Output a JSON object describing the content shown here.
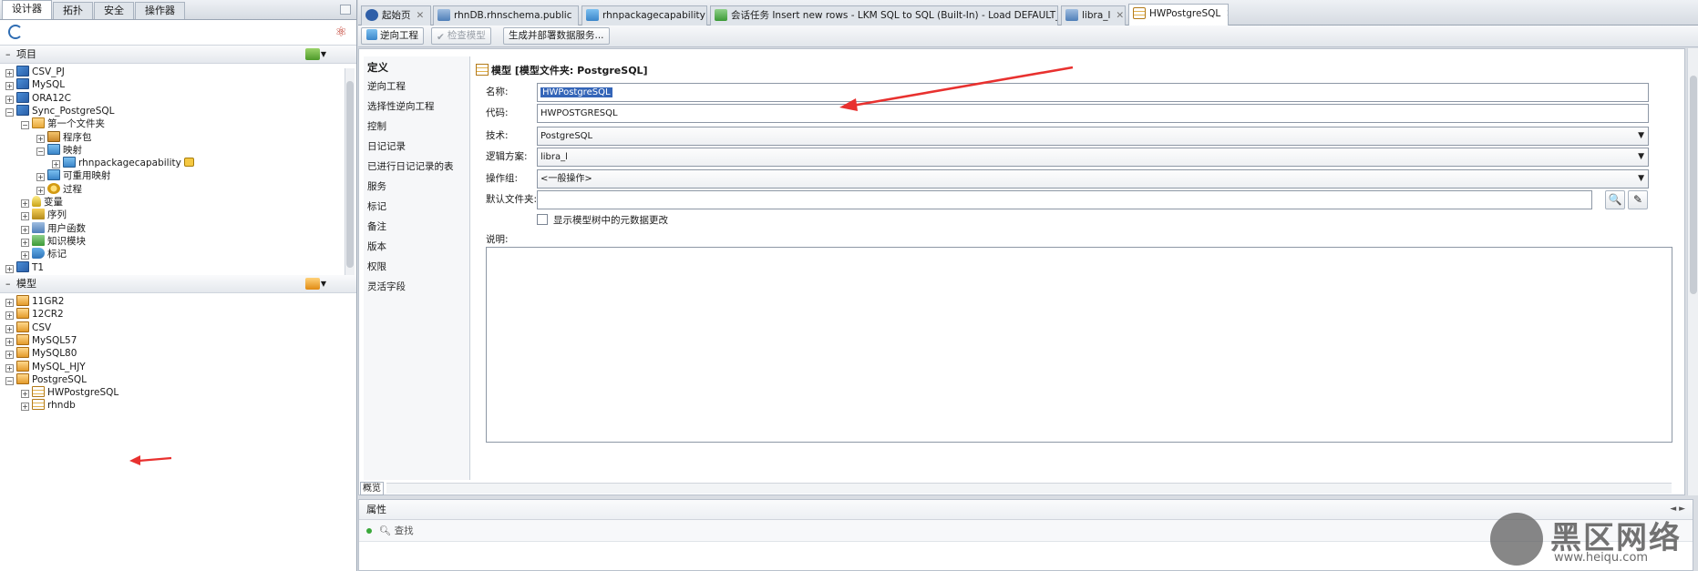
{
  "left": {
    "tabs": [
      "设计器",
      "拓扑",
      "安全",
      "操作器"
    ],
    "projects_header": "项目",
    "projects_tree": [
      {
        "label": "CSV_PJ",
        "icon": "database-icon",
        "exp": "+"
      },
      {
        "label": "MySQL",
        "icon": "database-icon",
        "exp": "+"
      },
      {
        "label": "ORA12C",
        "icon": "database-icon",
        "exp": "+"
      },
      {
        "label": "Sync_PostgreSQL",
        "icon": "database-icon",
        "exp": "-"
      },
      {
        "label": "第一个文件夹",
        "icon": "folder-icon",
        "exp": "-"
      },
      {
        "label": "程序包",
        "icon": "package-icon",
        "exp": "+"
      },
      {
        "label": "映射",
        "icon": "mapping-icon",
        "exp": "-"
      },
      {
        "label": "rhnpackagecapability",
        "icon": "mapping-icon",
        "exp": "+",
        "locked": true
      },
      {
        "label": "可重用映射",
        "icon": "reusable-mapping-icon",
        "exp": "+"
      },
      {
        "label": "过程",
        "icon": "procedure-icon",
        "exp": "+"
      },
      {
        "label": "变量",
        "icon": "variable-icon",
        "exp": "+"
      },
      {
        "label": "序列",
        "icon": "sequence-icon",
        "exp": "+"
      },
      {
        "label": "用户函数",
        "icon": "user-function-icon",
        "exp": "+"
      },
      {
        "label": "知识模块",
        "icon": "knowledge-module-icon",
        "exp": "+"
      },
      {
        "label": "标记",
        "icon": "marker-icon",
        "exp": "+"
      },
      {
        "label": "T1",
        "icon": "database-icon",
        "exp": "+"
      }
    ],
    "models_header": "模型",
    "models_tree": [
      {
        "label": "11GR2",
        "icon": "model-folder-icon",
        "exp": "+"
      },
      {
        "label": "12CR2",
        "icon": "model-folder-icon",
        "exp": "+"
      },
      {
        "label": "CSV",
        "icon": "model-folder-icon",
        "exp": "+"
      },
      {
        "label": "MySQL57",
        "icon": "model-folder-icon",
        "exp": "+"
      },
      {
        "label": "MySQL80",
        "icon": "model-folder-icon",
        "exp": "+"
      },
      {
        "label": "MySQL_HJY",
        "icon": "model-folder-icon",
        "exp": "+"
      },
      {
        "label": "PostgreSQL",
        "icon": "model-folder-icon",
        "exp": "-"
      },
      {
        "label": "HWPostgreSQL",
        "icon": "model-icon",
        "exp": "+"
      },
      {
        "label": "rhndb",
        "icon": "model-icon",
        "exp": "+"
      }
    ]
  },
  "editor_tabs": [
    {
      "label": "起始页",
      "icon": "help-icon"
    },
    {
      "label": "rhnDB.rhnschema.public",
      "icon": "datastore-icon"
    },
    {
      "label": "rhnpackagecapability",
      "icon": "mapping-icon"
    },
    {
      "label": "会话任务 Insert new rows - LKM SQL to SQL (Built-In) - Load DEFAULT_AP",
      "icon": "session-icon"
    },
    {
      "label": "libra_l",
      "icon": "logical-schema-icon"
    },
    {
      "label": "HWPostgreSQL",
      "icon": "model-icon",
      "active": true
    }
  ],
  "toolbar": {
    "reverse_engineer": "逆向工程",
    "check_model": "检查模型",
    "generate_deploy": "生成并部署数据服务..."
  },
  "nav": [
    "定义",
    "逆向工程",
    "选择性逆向工程",
    "控制",
    "日记记录",
    "已进行日记记录的表",
    "服务",
    "标记",
    "备注",
    "版本",
    "权限",
    "灵活字段"
  ],
  "overview_tab": "概览",
  "form": {
    "title": "模型 [模型文件夹: PostgreSQL]",
    "name_label": "名称:",
    "name_value": "HWPostgreSQL",
    "code_label": "代码:",
    "code_value": "HWPOSTGRESQL",
    "tech_label": "技术:",
    "tech_value": "PostgreSQL",
    "logical_schema_label": "逻辑方案:",
    "logical_schema_value": "libra_l",
    "op_group_label": "操作组:",
    "op_group_value": "<一般操作>",
    "default_folder_label": "默认文件夹:",
    "default_folder_value": "",
    "show_changes_label": "显示模型树中的元数据更改",
    "description_label": "说明:"
  },
  "properties": {
    "title": "属性",
    "search_placeholder": "查找"
  },
  "watermark": {
    "big": "黑区网络",
    "small": "www.heiqu.com"
  }
}
